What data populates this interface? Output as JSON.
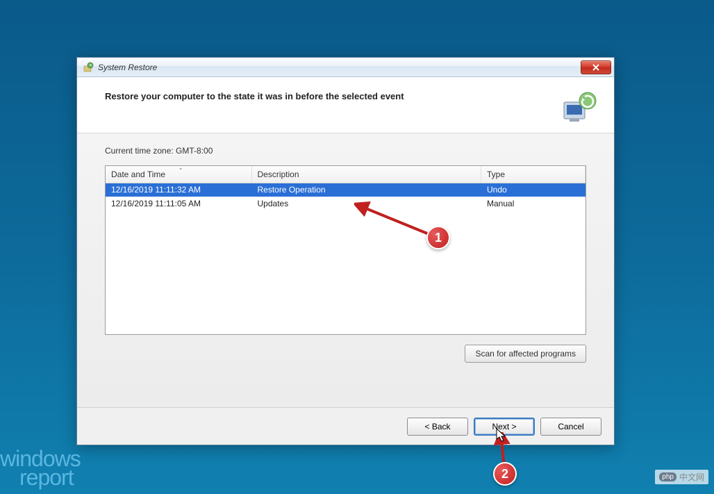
{
  "window": {
    "title": "System Restore"
  },
  "header": {
    "heading": "Restore your computer to the state it was in before the selected event"
  },
  "content": {
    "timezone_label": "Current time zone: GMT-8:00",
    "columns": {
      "date": "Date and Time",
      "description": "Description",
      "type": "Type"
    },
    "rows": [
      {
        "date": "12/16/2019 11:11:32 AM",
        "description": "Restore Operation",
        "type": "Undo",
        "selected": true
      },
      {
        "date": "12/16/2019 11:11:05 AM",
        "description": "Updates",
        "type": "Manual",
        "selected": false
      }
    ],
    "scan_button": "Scan for affected programs"
  },
  "footer": {
    "back": "< Back",
    "next": "Next >",
    "cancel": "Cancel"
  },
  "annotations": {
    "marker1": "1",
    "marker2": "2"
  },
  "watermark": {
    "left_line1": "windows",
    "left_line2": "report",
    "right_badge": "php",
    "right_text": "中文网"
  }
}
